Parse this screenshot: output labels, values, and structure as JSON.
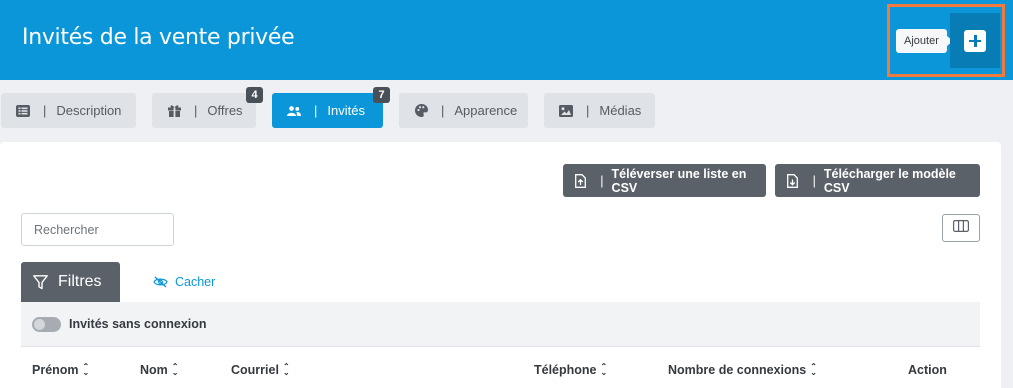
{
  "header": {
    "title": "Invités de la vente privée",
    "add_tooltip": "Ajouter",
    "add_icon": "plus-square-icon"
  },
  "tabs": [
    {
      "label": "Description",
      "icon": "list-icon"
    },
    {
      "label": "Offres",
      "icon": "gift-icon",
      "badge": "4"
    },
    {
      "label": "Invités",
      "icon": "users-icon",
      "badge": "7",
      "active": true
    },
    {
      "label": "Apparence",
      "icon": "palette-icon"
    },
    {
      "label": "Médias",
      "icon": "image-icon"
    }
  ],
  "toolbar": {
    "upload_csv_label": "Téléverser une liste en CSV",
    "download_template_label": "Télécharger le modèle CSV"
  },
  "search": {
    "placeholder": "Rechercher",
    "value": ""
  },
  "filters": {
    "tab_label": "Filtres",
    "hide_label": "Cacher",
    "toggle_label": "Invités sans connexion",
    "toggle_on": false
  },
  "table": {
    "columns": [
      "Prénom",
      "Nom",
      "Courriel",
      "Téléphone",
      "Nombre de connexions",
      "Action"
    ]
  },
  "colors": {
    "primary": "#0a96d8",
    "highlight_outline": "#f0793c",
    "dark_button": "#5a6168"
  }
}
